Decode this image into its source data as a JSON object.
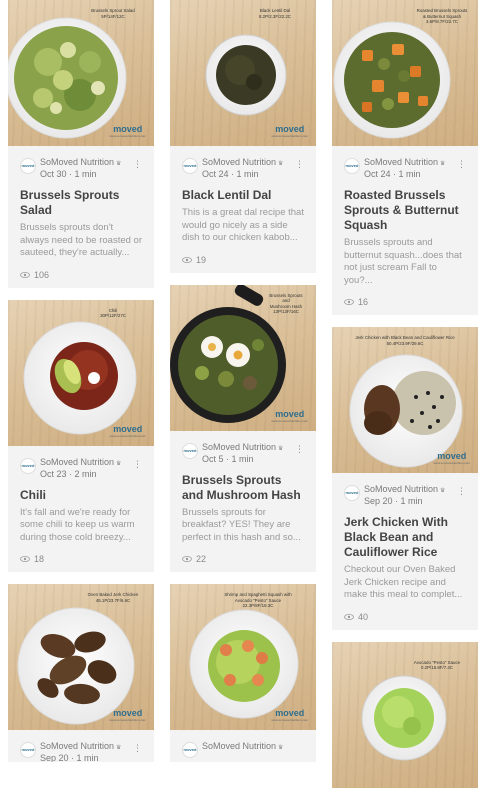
{
  "posts": [
    {
      "author": "SoMoved Nutrition",
      "date": "Oct 30",
      "read_time": "1 min",
      "title": "Brussels Sprouts Salad",
      "excerpt": "Brussels sprouts don't always need to be roasted or sauteed, they're actually...",
      "views": "106",
      "caption": "Brussels Sprout Salad\n5P/14F/12C"
    },
    {
      "author": "SoMoved Nutrition",
      "date": "Oct 24",
      "read_time": "1 min",
      "title": "Black Lentil Dal",
      "excerpt": "This is a great dal recipe that would go nicely as a side dish to our chicken kabob...",
      "views": "19",
      "caption": "Black Lentil Dal\n8.2P/2.3F/22.2C"
    },
    {
      "author": "SoMoved Nutrition",
      "date": "Oct 24",
      "read_time": "1 min",
      "title": "Roasted Brussels Sprouts & Butternut Squash",
      "excerpt": "Brussels sprouts and butternut squash...does that not just scream Fall to you?...",
      "views": "16",
      "caption": "Roasted Brussels Sprouts\n& Butternut Squash\n3.6P/8.7F/22.7C"
    },
    {
      "author": "SoMoved Nutrition",
      "date": "Oct 23",
      "read_time": "2 min",
      "title": "Chili",
      "excerpt": "It's fall and we're ready for some chili to keep us warm during those cold breezy...",
      "views": "18",
      "caption": "Chili\n30P/12F/27C"
    },
    {
      "author": "SoMoved Nutrition",
      "date": "Oct 5",
      "read_time": "1 min",
      "title": "Brussels Sprouts and Mushroom Hash",
      "excerpt": "Brussels sprouts for breakfast? YES! They are perfect in this hash and so...",
      "views": "22",
      "caption": "Brussels Sprouts\nand\nMushroom Hash\n13P/13F/16C"
    },
    {
      "author": "SoMoved Nutrition",
      "date": "Sep 20",
      "read_time": "1 min",
      "title": "Jerk Chicken With Black Bean and Cauliflower Rice",
      "excerpt": "Checkout our Oven Baked Jerk Chicken recipe and make this meal to complet...",
      "views": "40",
      "caption": "Jerk Chicken with Black Bean and Cauliflower Rice\n50.4P/23.9F/29.6C"
    },
    {
      "author": "SoMoved Nutrition",
      "date": "Sep 20",
      "read_time": "1 min",
      "caption": "Oven Baked Jerk Chicken\n45.1P/23.7F/6.6C"
    },
    {
      "author": "SoMoved Nutrition",
      "caption": "Shrimp and Spaghetti Squash with\nAvocado \"Pesto\" Sauce\n22.3P/8F/18.3C"
    },
    {
      "caption": "Avocado \"Pesto\" Sauce\n0.2P/15.8F/7.4C"
    }
  ],
  "logo": {
    "text": "moved",
    "sub": "www.somovednutrition.com"
  },
  "avatar_text": "moved",
  "icons": {
    "views": "eye-icon",
    "more": "kebab-icon",
    "crown": "crown-icon"
  },
  "colors": {
    "brand": "#2f6e8e",
    "card_bg": "#f3f3f3",
    "title": "#444444",
    "muted": "#9a9a9a"
  }
}
